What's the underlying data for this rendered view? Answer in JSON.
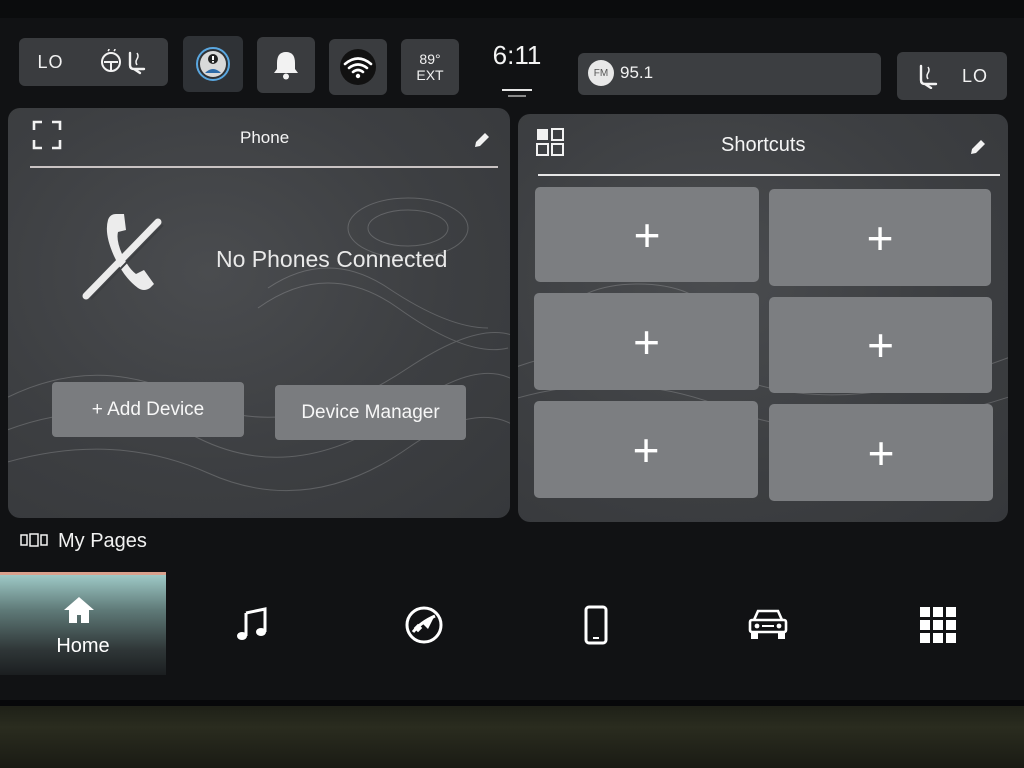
{
  "status_bar": {
    "left_climate": {
      "temp_label": "LO",
      "icon": "heated-seat-steering-icon"
    },
    "driver_assist_icon": "driver-alert-icon",
    "notifications_icon": "bell-icon",
    "wifi_icon": "wifi-icon",
    "outside_temp": {
      "value": "89°",
      "label": "EXT"
    },
    "time": "6:11",
    "radio": {
      "band": "FM",
      "frequency": "95.1"
    },
    "right_climate": {
      "temp_label": "LO",
      "icon": "heated-seat-icon"
    }
  },
  "phone_card": {
    "title": "Phone",
    "expand_icon": "expand-icon",
    "edit_icon": "pencil-icon",
    "status_icon": "phone-disconnected-icon",
    "status_text": "No Phones Connected",
    "add_device_label": "+ Add Device",
    "device_manager_label": "Device Manager"
  },
  "shortcuts_card": {
    "title": "Shortcuts",
    "grid_icon": "grid-icon",
    "edit_icon": "pencil-icon",
    "tiles": [
      "+",
      "+",
      "+",
      "+",
      "+",
      "+"
    ]
  },
  "my_pages": {
    "label": "My Pages",
    "icon": "pages-icon"
  },
  "bottom_nav": {
    "home": {
      "label": "Home",
      "icon": "home-icon"
    },
    "items": [
      "music-note-icon",
      "navigation-icon",
      "phone-icon",
      "vehicle-icon",
      "apps-grid-icon"
    ]
  },
  "colors": {
    "home_accent": "#9ec9c6",
    "home_border": "#d9a18d",
    "tile": "#7c7e81",
    "card": "#404245"
  }
}
